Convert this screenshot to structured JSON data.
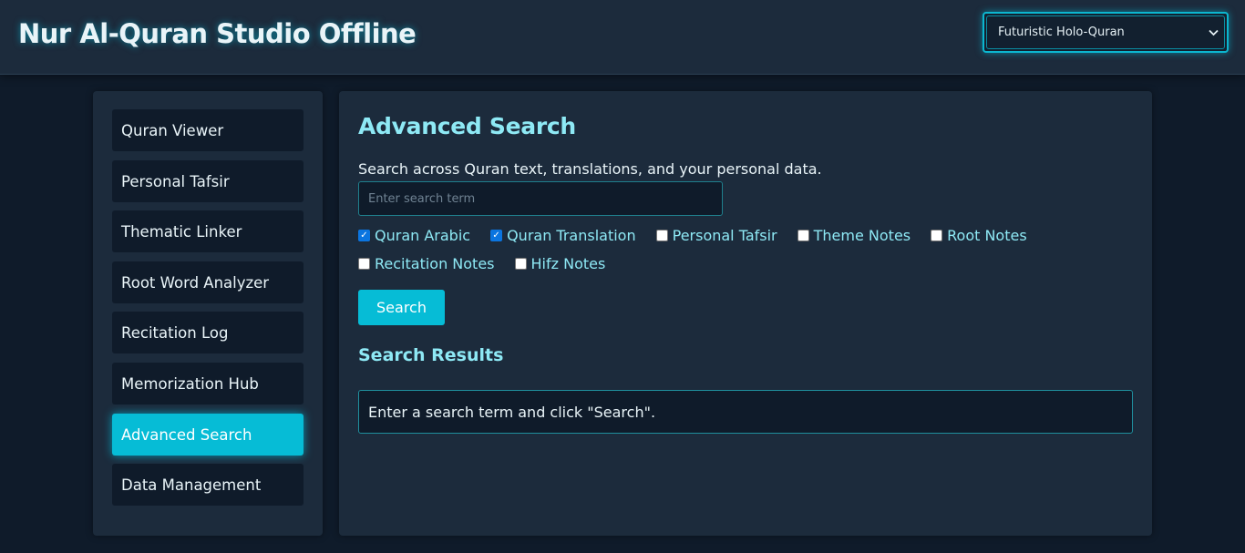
{
  "header": {
    "app_title": "Nur Al-Quran Studio Offline",
    "theme_select": {
      "selected": "Futuristic Holo-Quran",
      "icon": "chevron-down-icon"
    }
  },
  "sidebar": {
    "items": [
      {
        "label": "Quran Viewer",
        "active": false
      },
      {
        "label": "Personal Tafsir",
        "active": false
      },
      {
        "label": "Thematic Linker",
        "active": false
      },
      {
        "label": "Root Word Analyzer",
        "active": false
      },
      {
        "label": "Recitation Log",
        "active": false
      },
      {
        "label": "Memorization Hub",
        "active": false
      },
      {
        "label": "Advanced Search",
        "active": true
      },
      {
        "label": "Data Management",
        "active": false
      }
    ]
  },
  "main": {
    "title": "Advanced Search",
    "description": "Search across Quran text, translations, and your personal data.",
    "search": {
      "placeholder": "Enter search term",
      "value": ""
    },
    "filters": [
      {
        "label": "Quran Arabic",
        "checked": true
      },
      {
        "label": "Quran Translation",
        "checked": true
      },
      {
        "label": "Personal Tafsir",
        "checked": false
      },
      {
        "label": "Theme Notes",
        "checked": false
      },
      {
        "label": "Root Notes",
        "checked": false
      },
      {
        "label": "Recitation Notes",
        "checked": false
      },
      {
        "label": "Hifz Notes",
        "checked": false
      }
    ],
    "search_button_label": "Search",
    "results_title": "Search Results",
    "results_message": "Enter a search term and click \"Search\"."
  },
  "colors": {
    "accent": "#06bcd6",
    "heading": "#8ee9f5",
    "panel": "#1c2b3c",
    "background": "#0f1b2a"
  }
}
